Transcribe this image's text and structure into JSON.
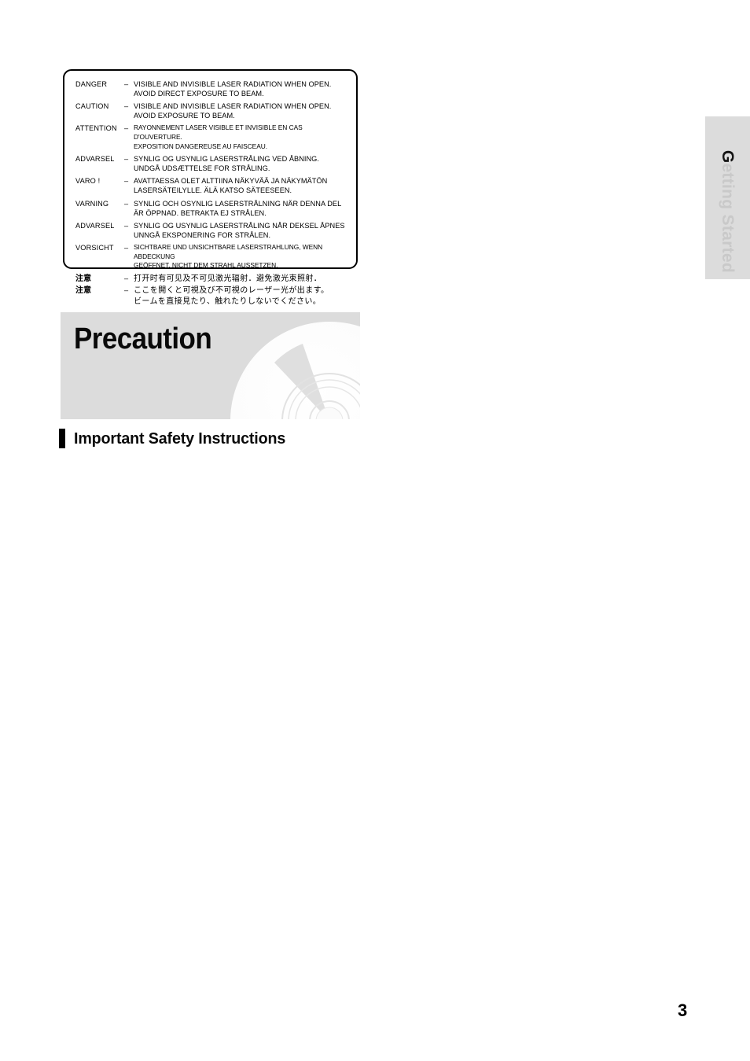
{
  "chapter_tab": {
    "label": "Getting Started",
    "first_letter": "G",
    "rest": "etting Started",
    "background_color": "#dcdcdc",
    "text_color": "#c9c9c9",
    "accent_letter_color": "#141414"
  },
  "warning_label": {
    "rows": [
      {
        "term": "DANGER",
        "dash": "–",
        "line1": "VISIBLE AND INVISIBLE LASER RADIATION WHEN OPEN.",
        "line2": "AVOID DIRECT EXPOSURE TO BEAM."
      },
      {
        "term": "CAUTION",
        "dash": "–",
        "line1": "VISIBLE AND INVISIBLE LASER RADIATION WHEN OPEN.",
        "line2": "AVOID EXPOSURE TO BEAM."
      },
      {
        "term": "ATTENTION",
        "dash": "–",
        "line1": "RAYONNEMENT LASER VISIBLE ET INVISIBLE EN CAS D'OUVERTURE.",
        "line2": "EXPOSITION DANGEREUSE AU FAISCEAU."
      },
      {
        "term": "ADVARSEL",
        "dash": "–",
        "line1": "SYNLIG OG USYNLIG LASERSTRÅLING VED ÅBNING.",
        "line2": "UNDGÅ UDSÆTTELSE FOR STRÅLING."
      },
      {
        "term": "VARO !",
        "dash": "–",
        "line1": "AVATTAESSA OLET ALTTIINA NÄKYVÄÄ JA NÄKYMÄTÖN",
        "line2": "LASERSÄTEILYLLE. ÄLÄ KATSO SÄTEESEEN."
      },
      {
        "term": "VARNING",
        "dash": "–",
        "line1": "SYNLIG OCH OSYNLIG LASERSTRÅLNING NÄR DENNA DEL",
        "line2": "ÄR ÖPPNAD. BETRAKTA EJ STRÅLEN."
      },
      {
        "term": "ADVARSEL",
        "dash": "–",
        "line1": "SYNLIG OG USYNLIG LASERSTRÅLING NÅR DEKSEL ÅPNES",
        "line2": "UNNGÅ EKSPONERING FOR STRÅLEN."
      },
      {
        "term": "VORSICHT",
        "dash": "–",
        "line1": "SICHTBARE UND UNSICHTBARE LASERSTRAHLUNG, WENN ABDECKUNG",
        "line2": "GEÖFFNET. NICHT DEM STRAHL AUSSETZEN."
      },
      {
        "term": "注意",
        "dash": "–",
        "line1": "打开时有可见及不可见激光辐射．避免激光束照射．",
        "line2": ""
      },
      {
        "term": "注意",
        "dash": "–",
        "line1": "ここを開くと可視及び不可視のレーザー光が出ます。",
        "line2": "ビームを直接見たり、触れたりしないでください。"
      }
    ]
  },
  "section": {
    "title": "Precaution",
    "banner_color": "#dcdcdc",
    "art": "compact-disc-icon"
  },
  "subheading": {
    "text": "Important Safety Instructions",
    "bar_color": "#000000"
  },
  "footer": {
    "page_number": "3"
  }
}
